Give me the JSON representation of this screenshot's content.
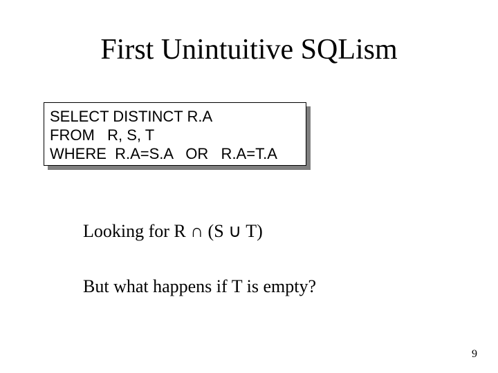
{
  "title": "First Unintuitive SQLism",
  "code": {
    "l1": "SELECT DISTINCT R.A",
    "l2": "FROM   R, S, T",
    "l3": "WHERE  R.A=S.A   OR   R.A=T.A"
  },
  "body": {
    "looking": "Looking for   R ∩ (S ∪ T)",
    "question": "But what happens if T is empty?"
  },
  "page": "9"
}
